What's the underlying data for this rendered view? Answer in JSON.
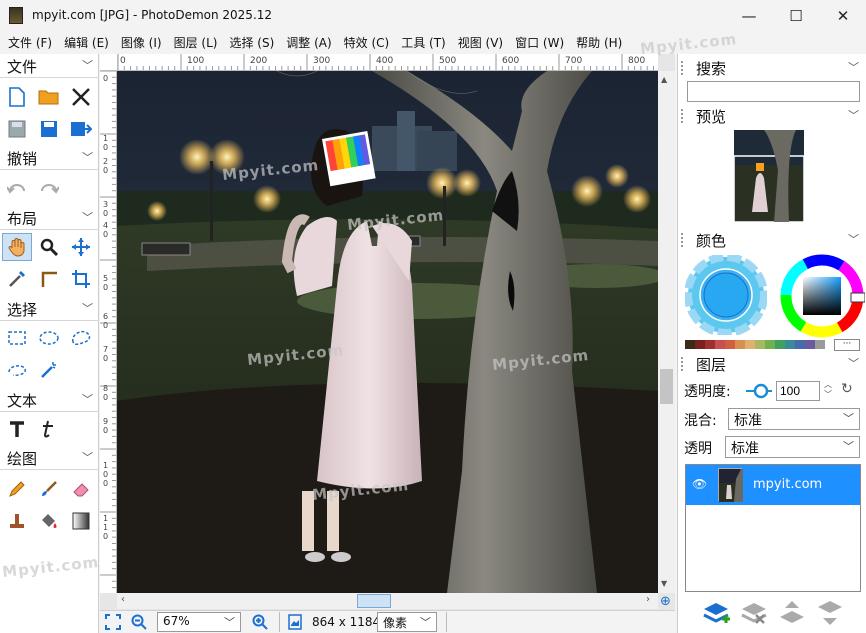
{
  "window": {
    "title": "mpyit.com [JPG]  -  PhotoDemon 2025.12",
    "minimize": "—",
    "maximize": "☐",
    "close": "✕"
  },
  "menu": [
    "文件 (F)",
    "编辑 (E)",
    "图像 (I)",
    "图层 (L)",
    "选择 (S)",
    "调整 (A)",
    "特效 (C)",
    "工具 (T)",
    "视图 (V)",
    "窗口 (W)",
    "帮助 (H)"
  ],
  "left_panel": {
    "file": "文件",
    "undo": "撤销",
    "layout": "布局",
    "select": "选择",
    "text": "文本",
    "paint": "绘图"
  },
  "rulers": {
    "h_ticks": [
      "0",
      "100",
      "200",
      "300",
      "400",
      "500",
      "600",
      "700",
      "800"
    ],
    "v_ticks": [
      "0",
      "1",
      "0",
      "2",
      "0",
      "3",
      "0",
      "4",
      "0",
      "5",
      "0",
      "6",
      "0",
      "7",
      "0",
      "8",
      "0",
      "9",
      "0",
      "1",
      "0",
      "0",
      "1",
      "1",
      "0"
    ]
  },
  "status": {
    "zoom": "67%",
    "size": "864 x 1184",
    "unit": "像素"
  },
  "right_panel": {
    "search": "搜索",
    "search_value": "",
    "preview": "预览",
    "color": "颜色",
    "more": "···",
    "layers": "图层",
    "opacity_label": "透明度:",
    "opacity_value": "100",
    "blend_label": "混合:",
    "blend_value": "标准",
    "alpha_label": "透明",
    "alpha_value": "标准",
    "layer_name": "mpyit.com"
  },
  "palette": [
    "#3a2a1a",
    "#7a2020",
    "#a03030",
    "#c85050",
    "#d06040",
    "#d89050",
    "#e0b070",
    "#a8b860",
    "#70b050",
    "#40a060",
    "#3a8a9a",
    "#4a6ab0",
    "#6a5aa0",
    "#9a9a9a"
  ],
  "watermark": "Mpyit.com",
  "colors": {
    "accent": "#1a8cd8",
    "selected_layer": "#1e90ff"
  }
}
